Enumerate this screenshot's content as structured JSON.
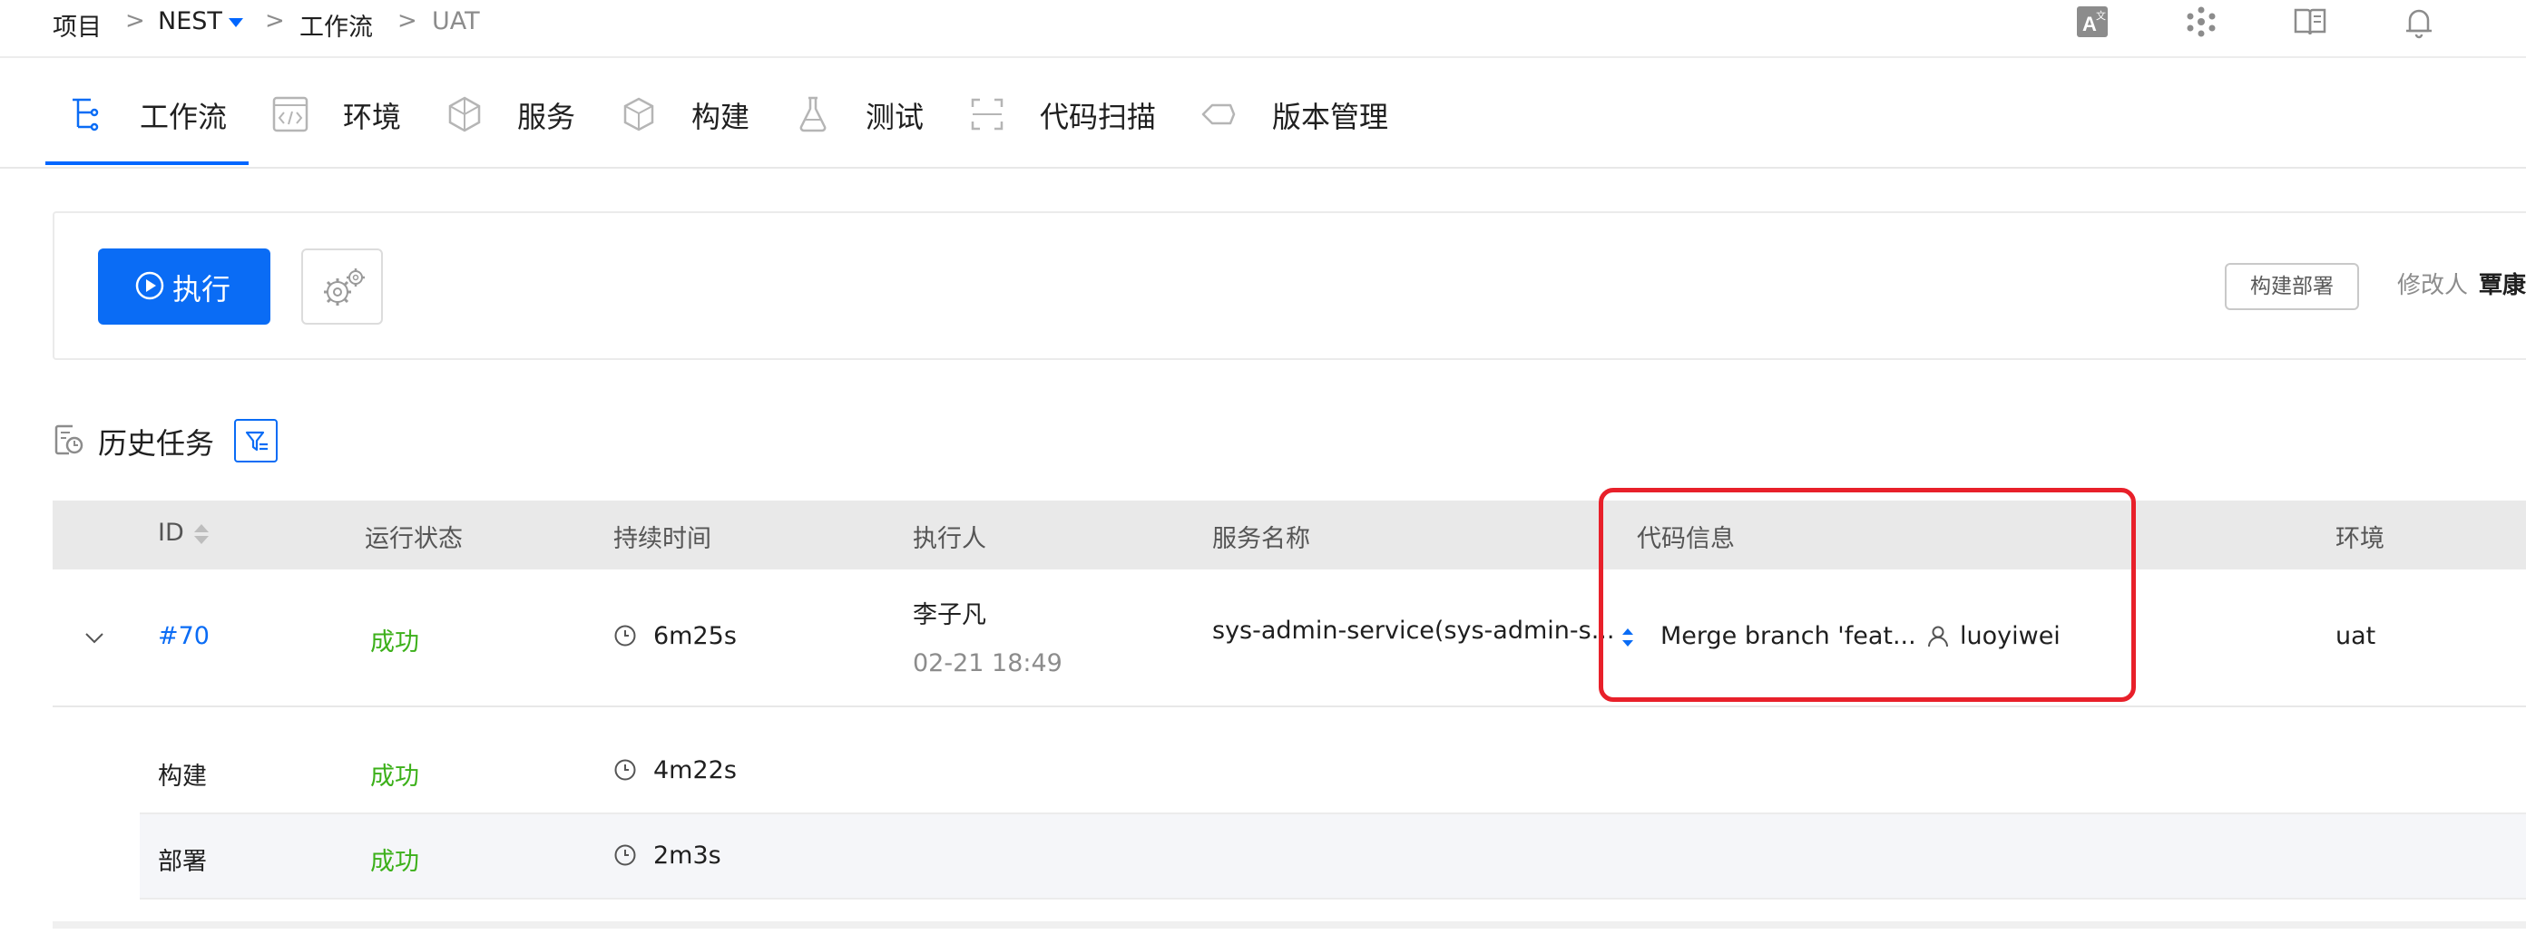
{
  "breadcrumb": {
    "root": "项目",
    "project": "NEST",
    "section": "工作流",
    "current": "UAT",
    "separator": ">"
  },
  "top_icons": [
    "translate-icon",
    "apps-icon",
    "docs-icon",
    "notification-bell-icon"
  ],
  "tabs": [
    {
      "label": "工作流",
      "icon": "workflow-icon",
      "active": true
    },
    {
      "label": "环境",
      "icon": "code-icon",
      "active": false
    },
    {
      "label": "服务",
      "icon": "cube-network-icon",
      "active": false
    },
    {
      "label": "构建",
      "icon": "box-icon",
      "active": false
    },
    {
      "label": "测试",
      "icon": "flask-icon",
      "active": false
    },
    {
      "label": "代码扫描",
      "icon": "scan-icon",
      "active": false
    },
    {
      "label": "版本管理",
      "icon": "tag-icon",
      "active": false
    }
  ],
  "actions": {
    "run_label": "执行",
    "deploy_tag": "构建部署",
    "modifier_label": "修改人",
    "modifier_name": "覃康"
  },
  "history": {
    "title": "历史任务"
  },
  "table": {
    "columns": [
      "ID",
      "运行状态",
      "持续时间",
      "执行人",
      "服务名称",
      "代码信息",
      "环境"
    ],
    "row": {
      "id": "#70",
      "status": "成功",
      "duration": "6m25s",
      "executor": "李子凡",
      "executed_at": "02-21 18:49",
      "service": "sys-admin-service(sys-admin-s...",
      "commit_message": "Merge branch 'feat...",
      "committer": "luoyiwei",
      "env": "uat"
    },
    "sub_rows": [
      {
        "stage": "构建",
        "status": "成功",
        "duration": "4m22s"
      },
      {
        "stage": "部署",
        "status": "成功",
        "duration": "2m3s"
      }
    ]
  },
  "colors": {
    "accent": "#0a6cf5",
    "success": "#3cb01a",
    "highlight": "#e8202a",
    "header_bg": "#e9e9e9"
  }
}
